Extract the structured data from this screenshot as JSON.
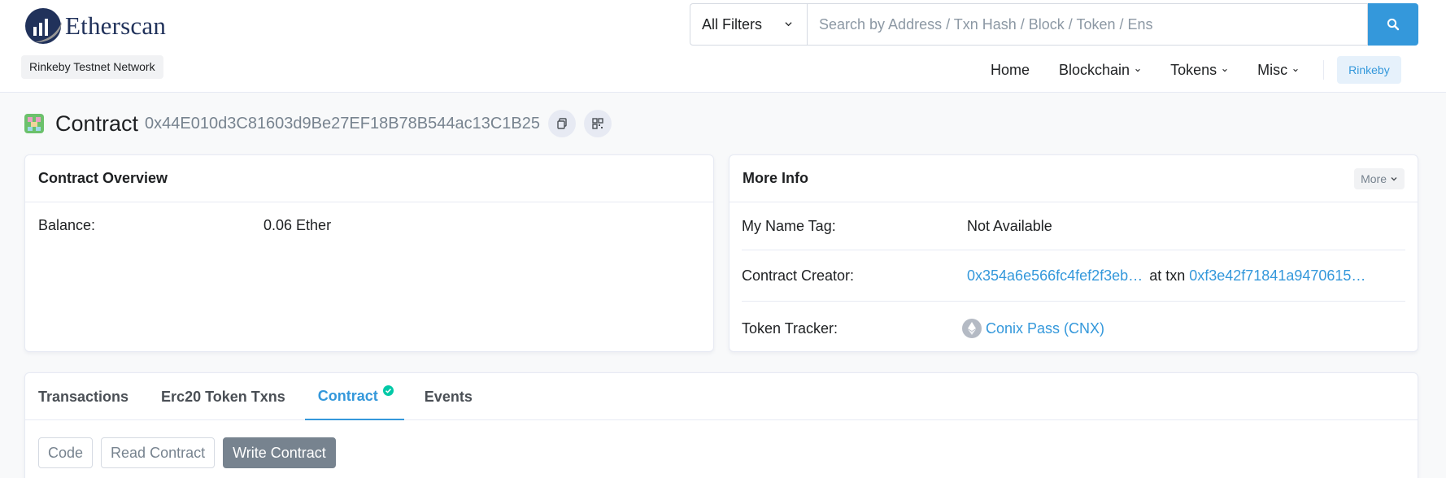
{
  "header": {
    "logo_text": "Etherscan",
    "network_badge": "Rinkeby Testnet Network",
    "search": {
      "filter_label": "All Filters",
      "placeholder": "Search by Address / Txn Hash / Block / Token / Ens"
    },
    "nav": [
      {
        "label": "Home"
      },
      {
        "label": "Blockchain"
      },
      {
        "label": "Tokens"
      },
      {
        "label": "Misc"
      }
    ],
    "network_button": "Rinkeby",
    "colors": {
      "accent": "#3498db",
      "brand": "#21325b"
    }
  },
  "page": {
    "title": "Contract",
    "address": "0x44E010d3C81603d9Be27EF18B78B544ac13C1B25"
  },
  "overview": {
    "title": "Contract Overview",
    "balance_label": "Balance:",
    "balance_value": "0.06 Ether"
  },
  "more_info": {
    "title": "More Info",
    "more_button": "More",
    "name_tag_label": "My Name Tag:",
    "name_tag_value": "Not Available",
    "creator_label": "Contract Creator:",
    "creator_address": "0x354a6e566fc4fef2f3eb…",
    "creator_at": "at txn",
    "creator_txn": "0xf3e42f71841a9470615…",
    "token_tracker_label": "Token Tracker:",
    "token_tracker_value": "Conix Pass (CNX)"
  },
  "tabs": {
    "items": [
      {
        "label": "Transactions"
      },
      {
        "label": "Erc20 Token Txns"
      },
      {
        "label": "Contract"
      },
      {
        "label": "Events"
      }
    ],
    "sub_buttons": [
      {
        "label": "Code"
      },
      {
        "label": "Read Contract"
      },
      {
        "label": "Write Contract"
      }
    ]
  }
}
